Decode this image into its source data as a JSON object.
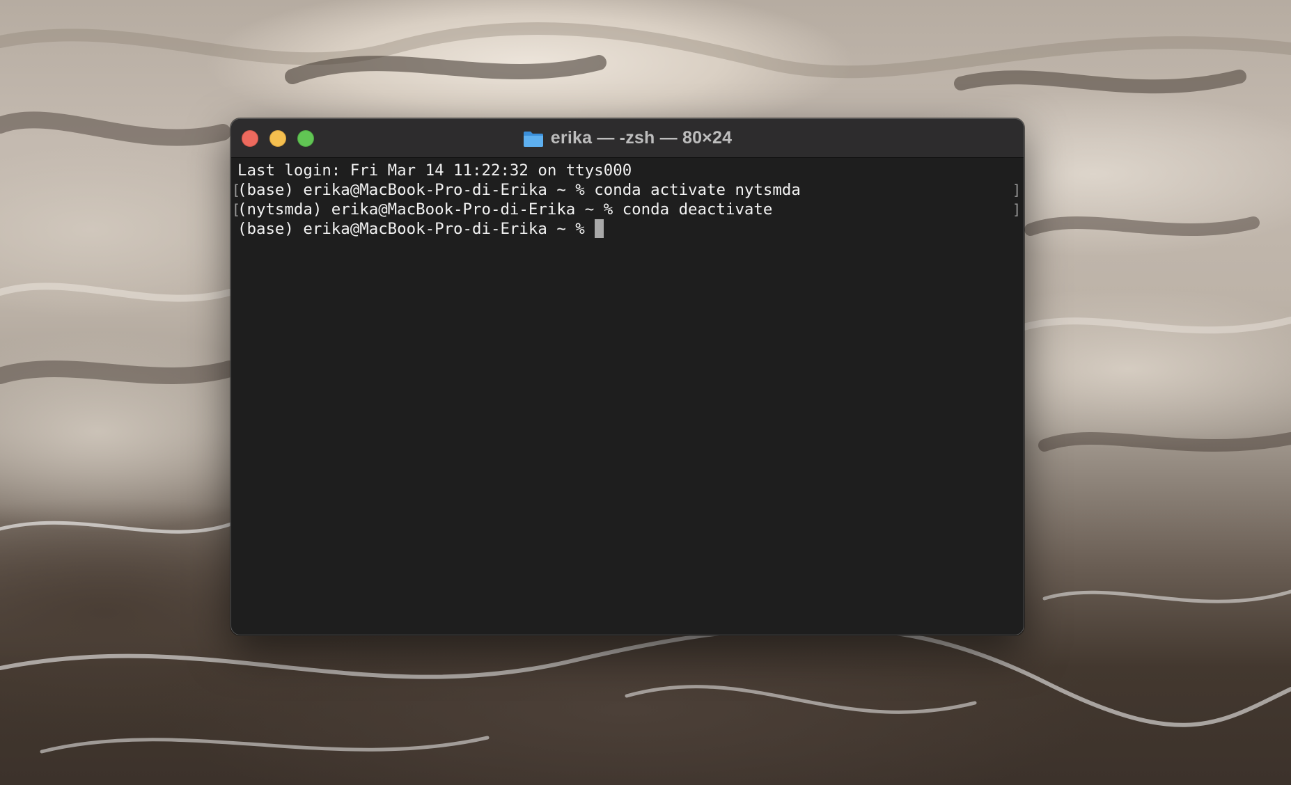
{
  "window": {
    "title": "erika — -zsh — 80×24",
    "controls": {
      "close_color": "#ed6a5e",
      "minimize_color": "#f5bf4f",
      "zoom_color": "#61c554"
    },
    "title_icon": "folder-icon"
  },
  "terminal": {
    "lines": [
      "Last login: Fri Mar 14 11:22:32 on ttys000",
      "(base) erika@MacBook-Pro-di-Erika ~ % conda activate nytsmda",
      "(nytsmda) erika@MacBook-Pro-di-Erika ~ % conda deactivate",
      "(base) erika@MacBook-Pro-di-Erika ~ % "
    ],
    "background": "#1e1e1e",
    "foreground": "#f2f2f2"
  }
}
